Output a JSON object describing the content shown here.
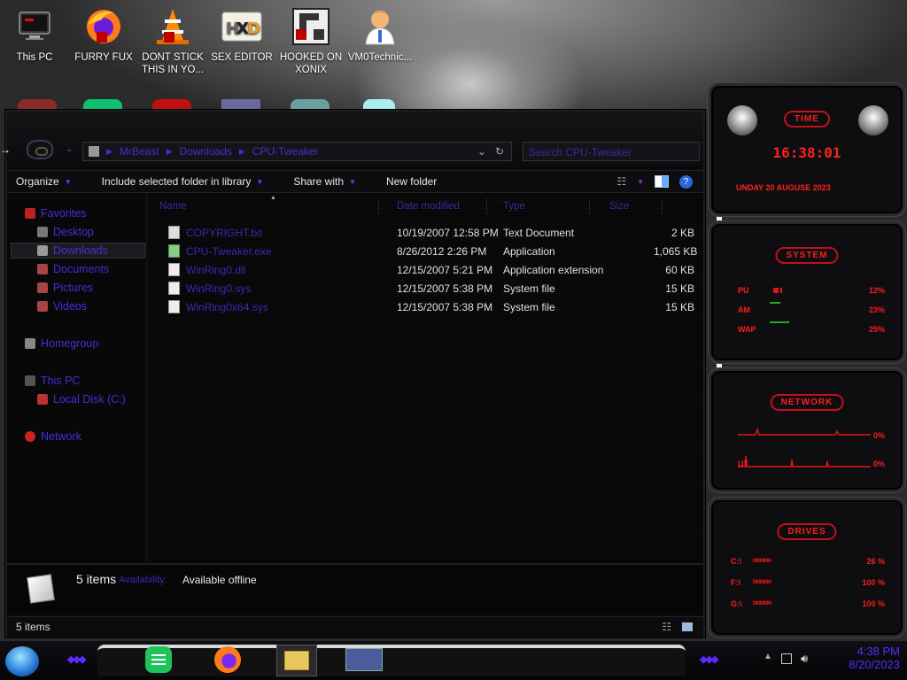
{
  "desktop_icons": [
    {
      "label": "This PC",
      "icon": "monitor-icon"
    },
    {
      "label": "FURRY FUX",
      "icon": "firefox-icon"
    },
    {
      "label": "DONT STICK THIS IN YO...",
      "icon": "vlc-cone-icon"
    },
    {
      "label": "SEX EDITOR",
      "icon": "hxd-icon"
    },
    {
      "label": "HOOKED ON XONIX",
      "icon": "game-icon"
    },
    {
      "label": "VM0Technic...",
      "icon": "doctor-avatar-icon"
    }
  ],
  "explorer": {
    "address_path": [
      "MrBeast",
      "Downloads",
      "CPU-Tweaker"
    ],
    "search_placeholder": "Search CPU-Tweaker",
    "toolbar": {
      "organize": "Organize",
      "include": "Include selected folder in library",
      "share": "Share with",
      "new_folder": "New folder"
    },
    "nav": {
      "favorites": "Favorites",
      "desktop": "Desktop",
      "downloads": "Downloads",
      "documents": "Documents",
      "pictures": "Pictures",
      "videos": "Videos",
      "homegroup": "Homegroup",
      "this_pc": "This PC",
      "local_disk": "Local Disk (C:)",
      "network": "Network"
    },
    "columns": {
      "name": "Name",
      "date": "Date modified",
      "type": "Type",
      "size": "Size"
    },
    "files": [
      {
        "name": "COPYRIGHT.txt",
        "date": "10/19/2007 12:58 PM",
        "type": "Text Document",
        "size": "2 KB"
      },
      {
        "name": "CPU-Tweaker.exe",
        "date": "8/26/2012 2:26 PM",
        "type": "Application",
        "size": "1,065 KB"
      },
      {
        "name": "WinRing0.dll",
        "date": "12/15/2007 5:21 PM",
        "type": "Application extension",
        "size": "60 KB"
      },
      {
        "name": "WinRing0.sys",
        "date": "12/15/2007 5:38 PM",
        "type": "System file",
        "size": "15 KB"
      },
      {
        "name": "WinRing0x64.sys",
        "date": "12/15/2007 5:38 PM",
        "type": "System file",
        "size": "15 KB"
      }
    ],
    "details": {
      "count": "5 items",
      "availability_label": "Availability:",
      "availability_value": "Available offline"
    },
    "status": "5 items"
  },
  "gadgets": {
    "time": {
      "title": "TIME",
      "clock": "16:38:01",
      "date": "UNDAY 20 AUGUSE 2023"
    },
    "system": {
      "title": "SYSTEM",
      "rows": [
        {
          "label": "PU",
          "value": "12%",
          "fill": 0.12
        },
        {
          "label": "AM",
          "value": "23%",
          "fill": 0.23
        },
        {
          "label": "WAP",
          "value": "25%",
          "fill": 0.25
        }
      ]
    },
    "network": {
      "title": "NETWORK",
      "rows": [
        {
          "label": "",
          "value": "0%"
        },
        {
          "label": "UT",
          "value": "0%"
        }
      ]
    },
    "drives": {
      "title": "DRIVES",
      "rows": [
        {
          "label": "C:\\",
          "value": "26 %"
        },
        {
          "label": "F:\\",
          "value": "100 %"
        },
        {
          "label": "G:\\",
          "value": "100 %"
        }
      ]
    }
  },
  "taskbar": {
    "time": "4:38 PM",
    "date": "8/20/2023"
  },
  "colors": {
    "accent": "#4b2bd8",
    "gadget_red": "#ff1c1c"
  }
}
